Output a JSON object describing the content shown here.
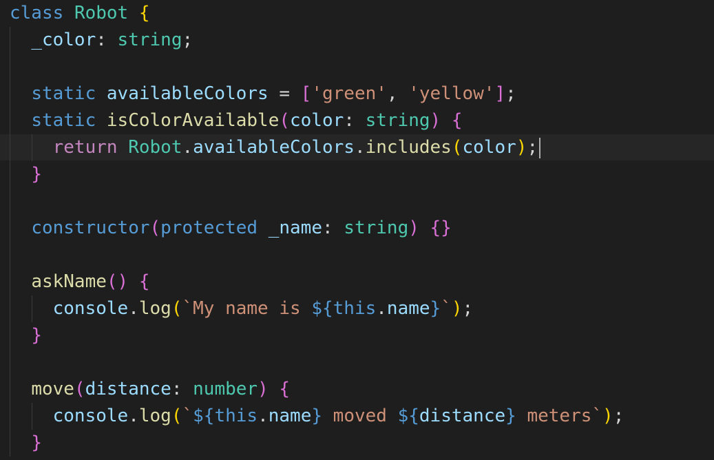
{
  "editor": {
    "language": "TypeScript",
    "theme": {
      "background": "#1e1e1e",
      "foreground": "#d4d4d4",
      "keyword": "#569cd6",
      "control_keyword": "#c586c0",
      "type": "#4ec9b0",
      "property": "#9cdcfe",
      "function": "#dcdcaa",
      "string": "#ce9178"
    },
    "lines": [
      [
        [
          "kw-storage",
          "class"
        ],
        [
          "punct",
          " "
        ],
        [
          "cls",
          "Robot"
        ],
        [
          "punct",
          " "
        ],
        [
          "brace",
          "{"
        ]
      ],
      [
        [
          "punct",
          "  "
        ],
        [
          "prop",
          "_color"
        ],
        [
          "punct",
          ": "
        ],
        [
          "type",
          "string"
        ],
        [
          "punct",
          ";"
        ]
      ],
      [],
      [
        [
          "punct",
          "  "
        ],
        [
          "kw-storage",
          "static"
        ],
        [
          "punct",
          " "
        ],
        [
          "prop",
          "availableColors"
        ],
        [
          "punct",
          " = "
        ],
        [
          "paren",
          "["
        ],
        [
          "str",
          "'green'"
        ],
        [
          "punct",
          ", "
        ],
        [
          "str",
          "'yellow'"
        ],
        [
          "paren",
          "]"
        ],
        [
          "punct",
          ";"
        ]
      ],
      [
        [
          "punct",
          "  "
        ],
        [
          "kw-storage",
          "static"
        ],
        [
          "punct",
          " "
        ],
        [
          "fn",
          "isColorAvailable"
        ],
        [
          "paren",
          "("
        ],
        [
          "var",
          "color"
        ],
        [
          "punct",
          ": "
        ],
        [
          "type",
          "string"
        ],
        [
          "paren",
          ")"
        ],
        [
          "punct",
          " "
        ],
        [
          "paren",
          "{"
        ]
      ],
      [
        [
          "punct",
          "    "
        ],
        [
          "kw-control",
          "return"
        ],
        [
          "punct",
          " "
        ],
        [
          "cls",
          "Robot"
        ],
        [
          "punct",
          "."
        ],
        [
          "prop",
          "availableColors"
        ],
        [
          "punct",
          "."
        ],
        [
          "fn",
          "includes"
        ],
        [
          "brace",
          "("
        ],
        [
          "var",
          "color"
        ],
        [
          "brace",
          ")"
        ],
        [
          "punct",
          ";"
        ]
      ],
      [
        [
          "punct",
          "  "
        ],
        [
          "paren",
          "}"
        ]
      ],
      [],
      [
        [
          "punct",
          "  "
        ],
        [
          "kw-storage",
          "constructor"
        ],
        [
          "paren",
          "("
        ],
        [
          "kw-storage",
          "protected"
        ],
        [
          "punct",
          " "
        ],
        [
          "var",
          "_name"
        ],
        [
          "punct",
          ": "
        ],
        [
          "type",
          "string"
        ],
        [
          "paren",
          ")"
        ],
        [
          "punct",
          " "
        ],
        [
          "paren",
          "{}"
        ]
      ],
      [],
      [
        [
          "punct",
          "  "
        ],
        [
          "fn",
          "askName"
        ],
        [
          "paren",
          "()"
        ],
        [
          "punct",
          " "
        ],
        [
          "paren",
          "{"
        ]
      ],
      [
        [
          "punct",
          "    "
        ],
        [
          "var",
          "console"
        ],
        [
          "punct",
          "."
        ],
        [
          "fn",
          "log"
        ],
        [
          "brace",
          "("
        ],
        [
          "str",
          "`My name is "
        ],
        [
          "tmpl-punct",
          "${"
        ],
        [
          "this",
          "this"
        ],
        [
          "punct",
          "."
        ],
        [
          "prop",
          "name"
        ],
        [
          "tmpl-punct",
          "}"
        ],
        [
          "str",
          "`"
        ],
        [
          "brace",
          ")"
        ],
        [
          "punct",
          ";"
        ]
      ],
      [
        [
          "punct",
          "  "
        ],
        [
          "paren",
          "}"
        ]
      ],
      [],
      [
        [
          "punct",
          "  "
        ],
        [
          "fn",
          "move"
        ],
        [
          "paren",
          "("
        ],
        [
          "var",
          "distance"
        ],
        [
          "punct",
          ": "
        ],
        [
          "type",
          "number"
        ],
        [
          "paren",
          ")"
        ],
        [
          "punct",
          " "
        ],
        [
          "paren",
          "{"
        ]
      ],
      [
        [
          "punct",
          "    "
        ],
        [
          "var",
          "console"
        ],
        [
          "punct",
          "."
        ],
        [
          "fn",
          "log"
        ],
        [
          "brace",
          "("
        ],
        [
          "str",
          "`"
        ],
        [
          "tmpl-punct",
          "${"
        ],
        [
          "this",
          "this"
        ],
        [
          "punct",
          "."
        ],
        [
          "prop",
          "name"
        ],
        [
          "tmpl-punct",
          "}"
        ],
        [
          "str",
          " moved "
        ],
        [
          "tmpl-punct",
          "${"
        ],
        [
          "var",
          "distance"
        ],
        [
          "tmpl-punct",
          "}"
        ],
        [
          "str",
          " meters`"
        ],
        [
          "brace",
          ")"
        ],
        [
          "punct",
          ";"
        ]
      ],
      [
        [
          "punct",
          "  "
        ],
        [
          "paren",
          "}"
        ]
      ]
    ],
    "cursor_line": 6
  }
}
